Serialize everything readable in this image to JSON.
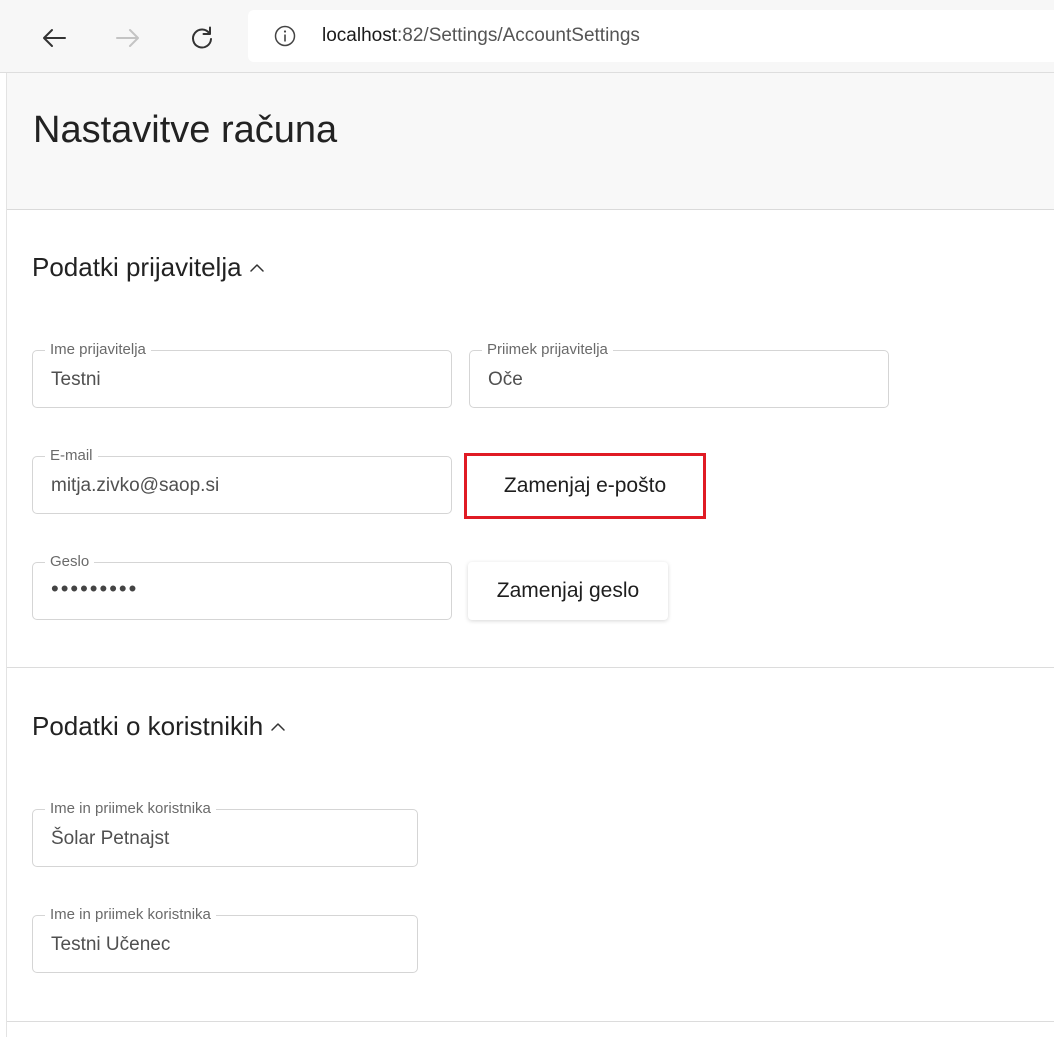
{
  "browser": {
    "url_host": "localhost",
    "url_path": ":82/Settings/AccountSettings"
  },
  "page": {
    "title": "Nastavitve računa"
  },
  "sections": {
    "applicant": {
      "title": "Podatki prijavitelja",
      "first_name": {
        "label": "Ime prijavitelja",
        "value": "Testni"
      },
      "last_name": {
        "label": "Priimek prijavitelja",
        "value": "Oče"
      },
      "email": {
        "label": "E-mail",
        "value": "mitja.zivko@saop.si"
      },
      "change_email_button": "Zamenjaj e-pošto",
      "password": {
        "label": "Geslo",
        "value": "•••••••••"
      },
      "change_password_button": "Zamenjaj geslo"
    },
    "users": {
      "title": "Podatki o koristnikih",
      "user_1": {
        "label": "Ime in priimek koristnika",
        "value": "Šolar Petnajst"
      },
      "user_2": {
        "label": "Ime in priimek koristnika",
        "value": "Testni Učenec"
      }
    }
  },
  "icons": {
    "back": "arrow-left-icon",
    "forward": "arrow-right-icon",
    "reload": "reload-icon",
    "site_info": "info-icon",
    "collapse": "chevron-up-icon"
  },
  "colors": {
    "highlight": "#e01b24"
  }
}
